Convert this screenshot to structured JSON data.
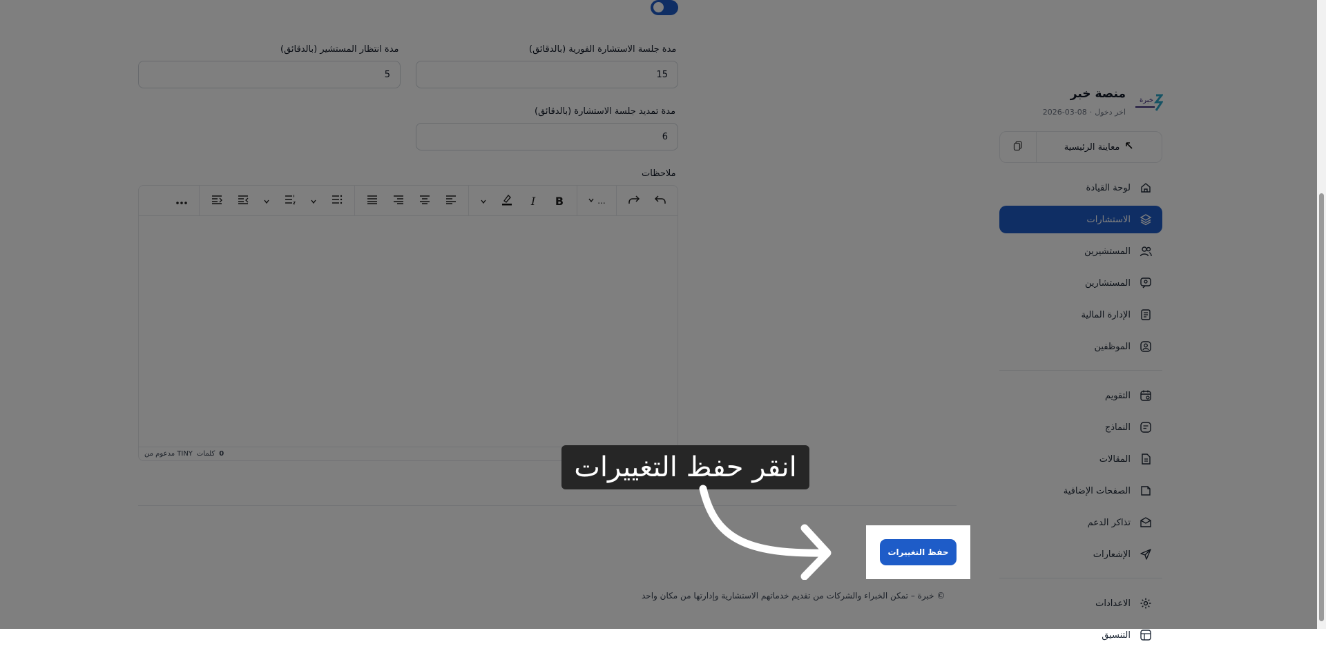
{
  "brand": {
    "name": "منصة خبر",
    "logo_text": "خبرة",
    "last_login_label": "اخر دخول",
    "last_login_date": "08-03-2026"
  },
  "preview": {
    "label": "معاينة الرئيسية"
  },
  "nav": {
    "group1": [
      {
        "label": "لوحة القيادة",
        "icon": "home-icon",
        "active": false
      },
      {
        "label": "الاستشارات",
        "icon": "layers-icon",
        "active": true
      },
      {
        "label": "المستشيرين",
        "icon": "users-icon",
        "active": false
      },
      {
        "label": "المستشارين",
        "icon": "chat-user-icon",
        "active": false
      },
      {
        "label": "الإدارة المالية",
        "icon": "document-icon",
        "active": false
      },
      {
        "label": "الموظفين",
        "icon": "user-badge-icon",
        "active": false
      }
    ],
    "group2": [
      {
        "label": "التقويم",
        "icon": "calendar-icon",
        "active": false
      },
      {
        "label": "النماذج",
        "icon": "form-icon",
        "active": false
      },
      {
        "label": "المقالات",
        "icon": "article-icon",
        "active": false
      },
      {
        "label": "الصفحات الإضافية",
        "icon": "pages-icon",
        "active": false
      },
      {
        "label": "تذاكر الدعم",
        "icon": "ticket-icon",
        "active": false
      },
      {
        "label": "الإشعارات",
        "icon": "send-icon",
        "active": false
      }
    ],
    "group3": [
      {
        "label": "الاعدادات",
        "icon": "gear-icon",
        "active": false
      },
      {
        "label": "التنسيق",
        "icon": "layout-icon",
        "active": false
      }
    ]
  },
  "form": {
    "instant_duration": {
      "label": "مدة جلسة الاستشارة الفورية (بالدقائق)",
      "value": "15"
    },
    "wait_duration": {
      "label": "مدة انتظار المستشير (بالدقائق)",
      "value": "5"
    },
    "extend_duration": {
      "label": "مدة تمديد جلسة الاستشارة (بالدقائق)",
      "value": "6"
    },
    "notes_label": "ملاحظات"
  },
  "editor": {
    "format_label": "...",
    "word_count": "0",
    "words_label": "كلمات",
    "powered_by": "مدعوم من TINY"
  },
  "actions": {
    "save_label": "حفظ التغييرات"
  },
  "hint": {
    "text": "انقر حفظ التغييرات"
  },
  "footer": {
    "text": "© خبرة – تمكن الخبراء والشركات من تقديم خدماتهم الاستشارية وإدارتها من مكان واحد"
  },
  "colors": {
    "primary": "#1e5cc8",
    "overlay": "rgba(0,0,0,0.5)",
    "hint_bg": "#262626"
  }
}
